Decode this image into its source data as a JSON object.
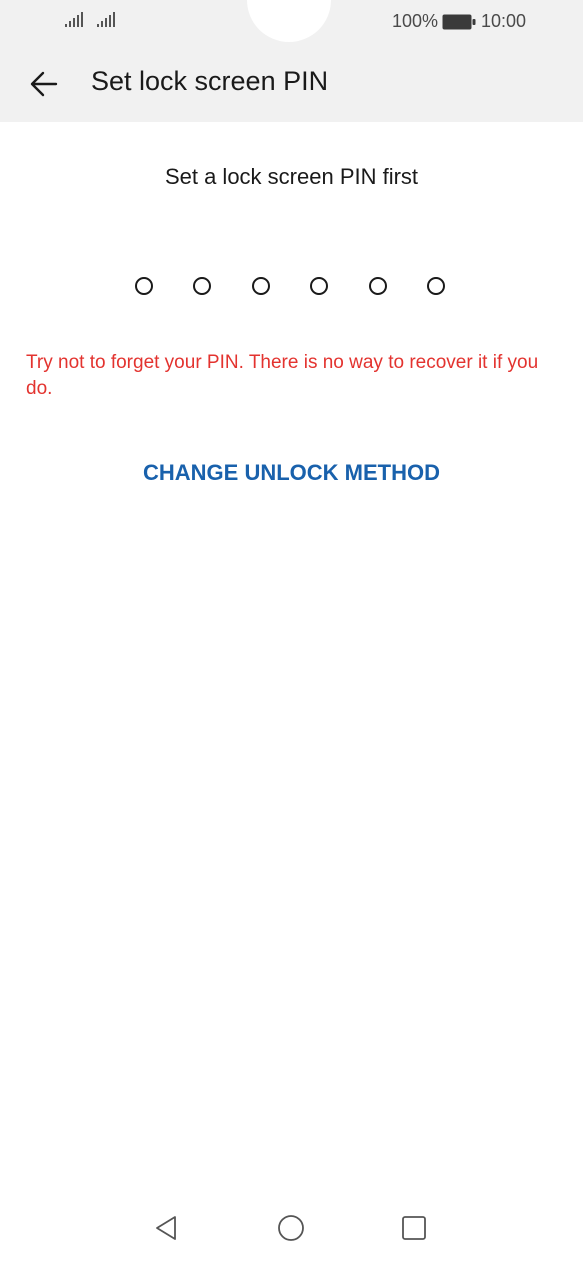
{
  "status_bar": {
    "battery_percent": "100%",
    "time": "10:00",
    "icons": [
      "signal-icon",
      "signal-icon",
      "battery-icon"
    ]
  },
  "header": {
    "title": "Set lock screen PIN",
    "back_icon": "arrow-left-icon"
  },
  "main": {
    "subtitle": "Set a lock screen PIN first",
    "pin_length": 6,
    "pin_entered": 0,
    "warning": "Try not to forget your PIN. There is no way to recover it if you do.",
    "change_method_label": "CHANGE UNLOCK METHOD"
  },
  "nav_bar": {
    "icons": [
      "nav-back-icon",
      "nav-home-icon",
      "nav-recents-icon"
    ]
  },
  "colors": {
    "header_bg": "#f1f1f1",
    "warning": "#e3332f",
    "accent": "#1961ac",
    "text": "#1a1a1a"
  }
}
